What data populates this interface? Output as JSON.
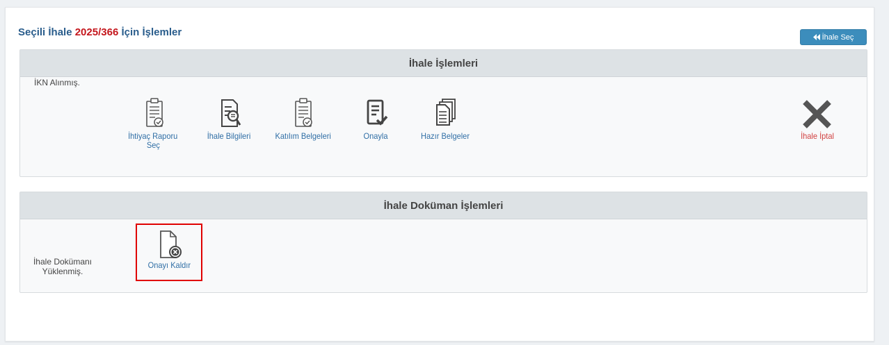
{
  "header": {
    "title_prefix": "Seçili İhale",
    "tender_number": "2025/366",
    "title_suffix": "İçin İşlemler",
    "select_button_label": "İhale Seç",
    "select_button_icon": "double-chevron-left-icon"
  },
  "tender_ops": {
    "heading": "İhale İşlemleri",
    "status_label": "İKN Alınmış.",
    "actions": [
      {
        "label_line1": "İhtiyaç Raporu",
        "label_line2": "Seç",
        "icon": "clipboard-check-icon"
      },
      {
        "label": "İhale Bilgileri",
        "icon": "document-search-icon"
      },
      {
        "label": "Katılım Belgeleri",
        "icon": "clipboard-check-icon"
      },
      {
        "label": "Onayla",
        "icon": "document-check-icon"
      },
      {
        "label": "Hazır Belgeler",
        "icon": "documents-stack-icon"
      }
    ],
    "cancel": {
      "label": "İhale İptal",
      "icon": "x-icon"
    }
  },
  "doc_ops": {
    "heading": "İhale Doküman İşlemleri",
    "status_label_line1": "İhale Dokümanı",
    "status_label_line2": "Yüklenmiş.",
    "actions": [
      {
        "label": "Onayı Kaldır",
        "icon": "file-remove-icon"
      }
    ]
  },
  "colors": {
    "title": "#2a5d8c",
    "tender_number": "#c4161c",
    "button": "#3c8dbc",
    "link": "#2f6ea5",
    "danger": "#d13f3f",
    "highlight": "#e00000"
  }
}
